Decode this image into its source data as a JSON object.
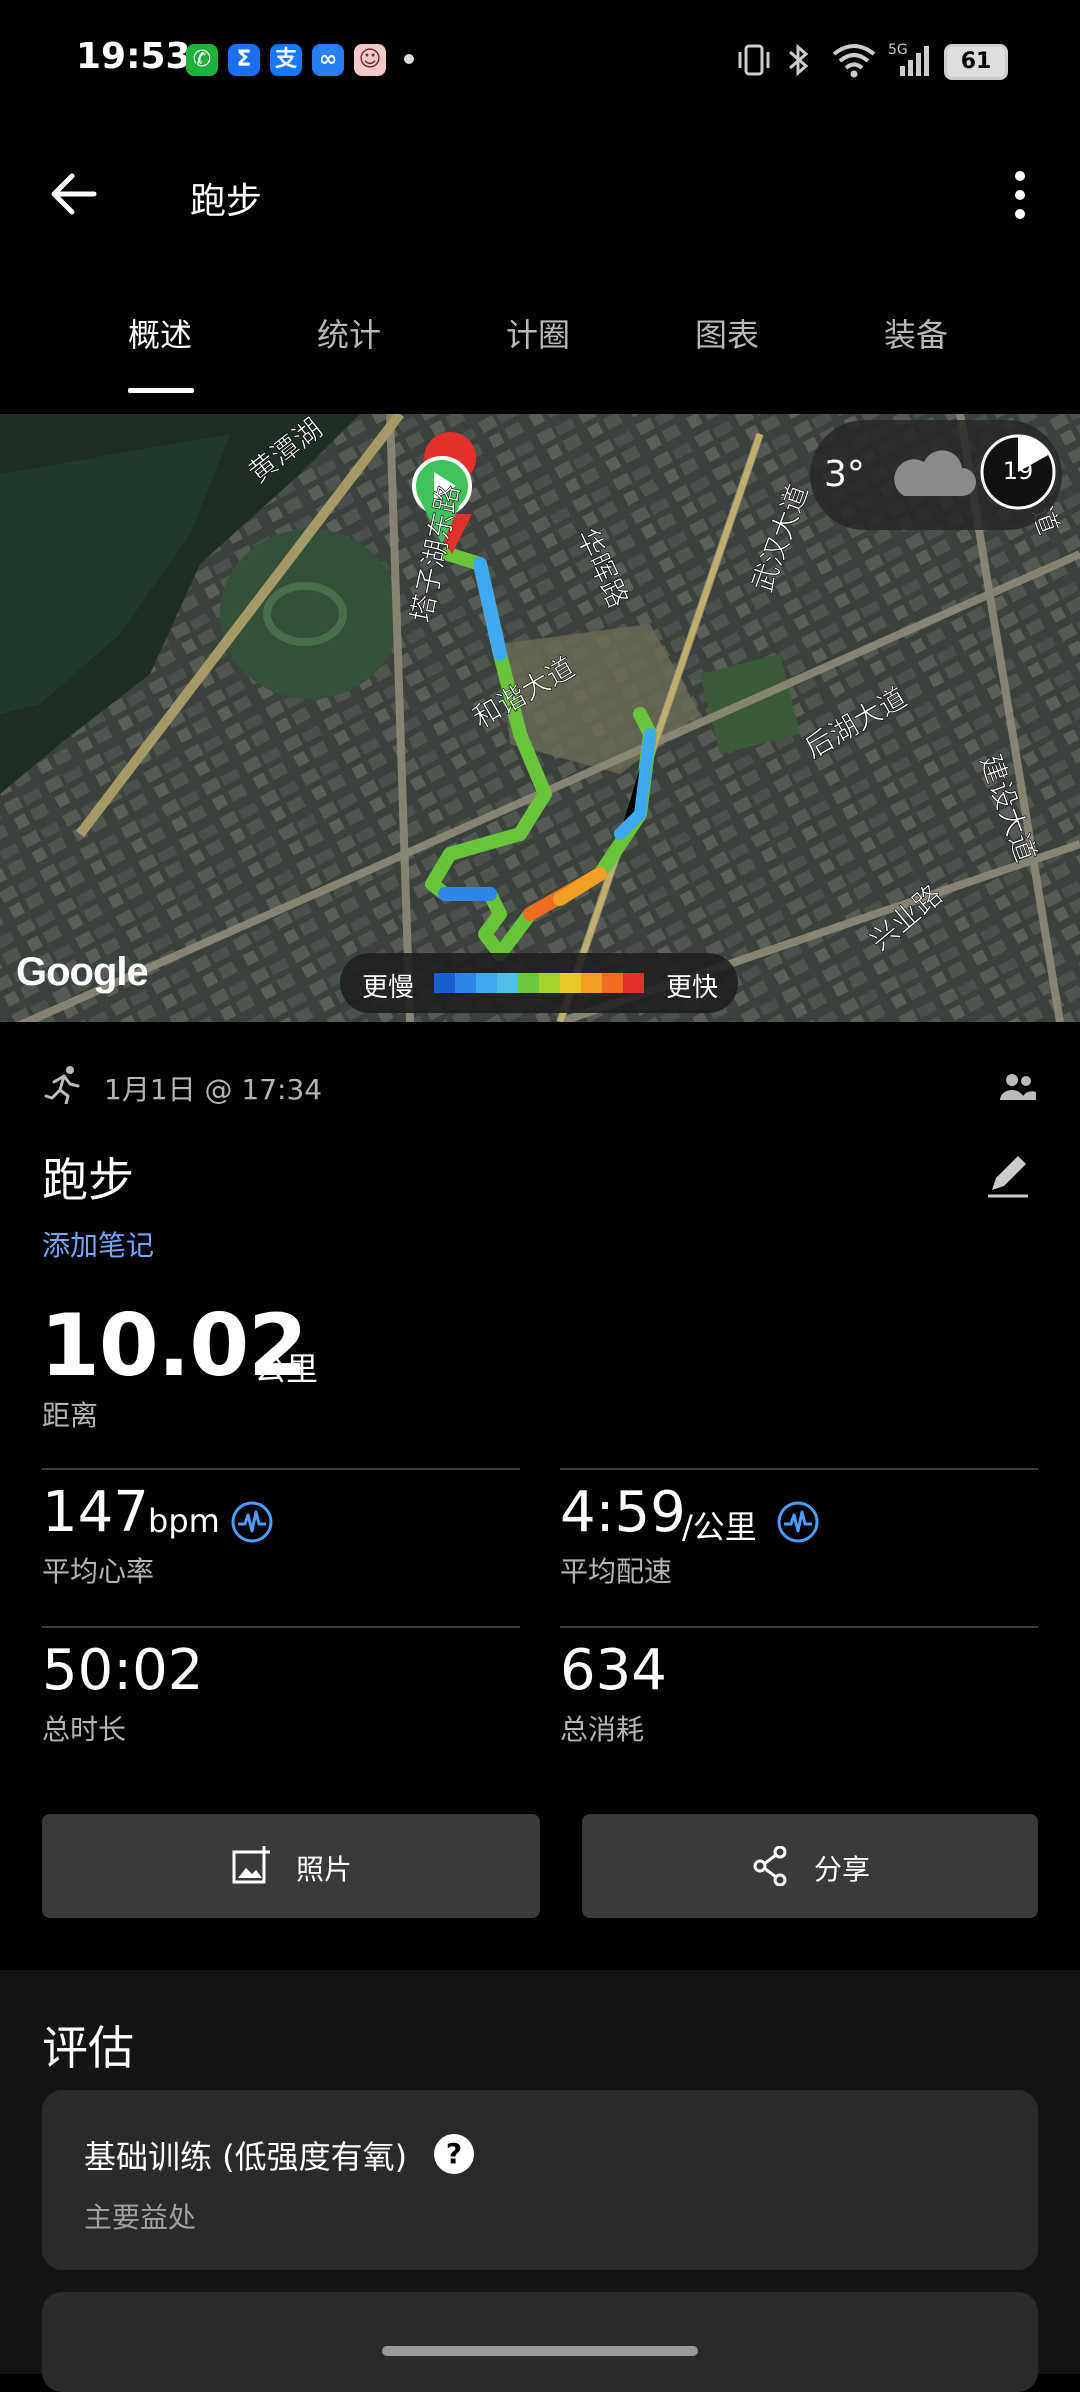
{
  "status_bar": {
    "time": "19:53",
    "network": "5G",
    "battery": "61",
    "app_icons": [
      {
        "name": "wechat-icon",
        "color": "#1fb13a",
        "glyph": "✆"
      },
      {
        "name": "sigma-app-icon",
        "color": "#1c6ef2",
        "glyph": "Σ"
      },
      {
        "name": "alipay-icon",
        "color": "#1677ff",
        "glyph": "支"
      },
      {
        "name": "cloud-app-icon",
        "color": "#2a7ff5",
        "glyph": "∞"
      },
      {
        "name": "avatar-app-icon",
        "color": "#f2c9c9",
        "glyph": "☺"
      }
    ]
  },
  "app_bar": {
    "title": "跑步"
  },
  "tabs": [
    "概述",
    "统计",
    "计圈",
    "图表",
    "装备"
  ],
  "map": {
    "provider": "Google",
    "weather_temp": "3°",
    "weather_icon": "cloud-icon",
    "day_badge": "19",
    "legend_slow": "更慢",
    "legend_fast": "更快",
    "legend_colors": [
      "#1a5fd0",
      "#2f86e6",
      "#3fa9f0",
      "#4fc0e8",
      "#6cc93b",
      "#a6d22c",
      "#e9c928",
      "#f2a023",
      "#ef6b1f",
      "#e4302a"
    ],
    "street_labels": [
      "黄潭湖",
      "塔子湖东路",
      "华晖路",
      "和谐大道",
      "武汉大道",
      "后湖大道",
      "建设大道",
      "兴业路",
      "大道"
    ]
  },
  "activity": {
    "date": "1月1日 @ 17:34",
    "name": "跑步",
    "add_note": "添加笔记",
    "distance_value": "10.02",
    "distance_unit": "公里",
    "distance_label": "距离",
    "metrics": [
      {
        "value": "147",
        "unit": "bpm",
        "label": "平均心率"
      },
      {
        "value": "4:59",
        "unit": "/公里",
        "label": "平均配速"
      },
      {
        "value": "50:02",
        "unit": "",
        "label": "总时长"
      },
      {
        "value": "634",
        "unit": "",
        "label": "总消耗"
      }
    ]
  },
  "buttons": {
    "photo": "照片",
    "share": "分享"
  },
  "evaluation": {
    "title": "评估",
    "card_title": "基础训练 (低强度有氧)",
    "card_sub": "主要益处",
    "help": "?"
  }
}
